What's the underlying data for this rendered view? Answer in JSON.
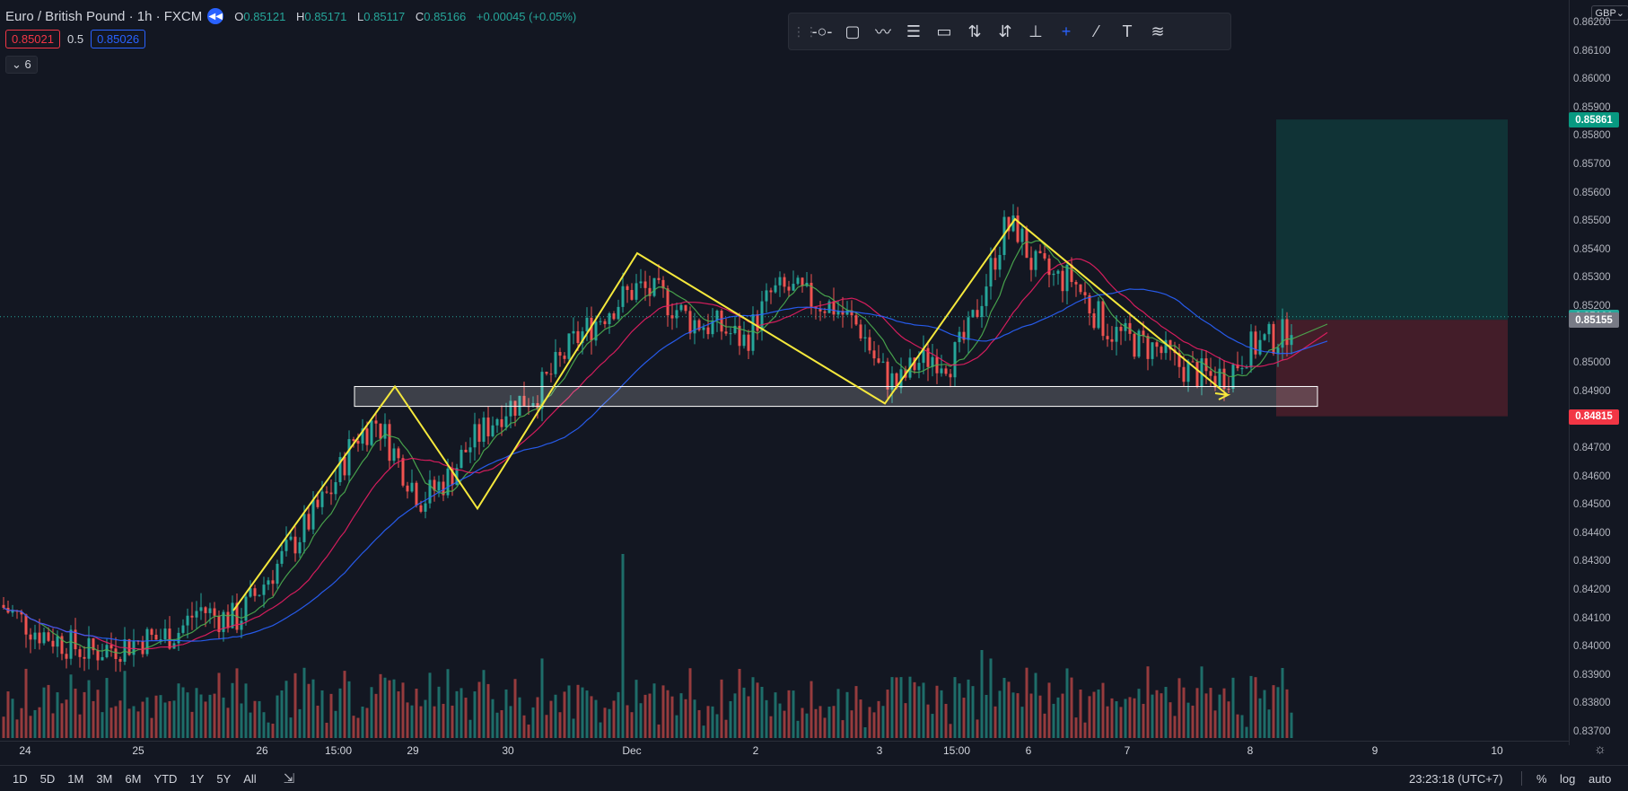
{
  "header": {
    "symbol": "Euro / British Pound · 1h · FXCM",
    "ohlc": [
      {
        "k": "O",
        "v": "0.85121"
      },
      {
        "k": "H",
        "v": "0.85171"
      },
      {
        "k": "L",
        "v": "0.85117"
      },
      {
        "k": "C",
        "v": "0.85166"
      }
    ],
    "change": "+0.00045 (+0.05%)",
    "sell_price": "0.85021",
    "spread": "0.5",
    "buy_price": "0.85026",
    "indicators_toggle": "6"
  },
  "toolbar_icons": [
    "horizontal-ray-icon",
    "rectangle-icon",
    "path-icon",
    "parallel-channel-icon",
    "callout-icon",
    "long-position-icon",
    "short-position-icon",
    "price-range-icon",
    "crosshair-icon",
    "trend-line-icon",
    "text-icon",
    "fib-fan-icon"
  ],
  "currency_button": "GBP",
  "price_axis": {
    "labels": [
      "0.86200",
      "0.86100",
      "0.86000",
      "0.85900",
      "0.85800",
      "0.85700",
      "0.85600",
      "0.85500",
      "0.85400",
      "0.85300",
      "0.85200",
      "0.85000",
      "0.84900",
      "0.84700",
      "0.84600",
      "0.84500",
      "0.84400",
      "0.84300",
      "0.84200",
      "0.84100",
      "0.84000",
      "0.83900",
      "0.83800",
      "0.83700"
    ],
    "tags": {
      "target": "0.85861",
      "last": "0.85166",
      "prev": "0.85155",
      "stop": "0.84815"
    }
  },
  "time_axis": [
    "24",
    "25",
    "26",
    "15:00",
    "29",
    "30",
    "Dec",
    "2",
    "3",
    "15:00",
    "6",
    "7",
    "8",
    "9",
    "10"
  ],
  "bottom_bar": {
    "ranges": [
      "1D",
      "5D",
      "1M",
      "3M",
      "6M",
      "YTD",
      "1Y",
      "5Y",
      "All"
    ],
    "clock": "23:23:18 (UTC+7)",
    "percent": "%",
    "log": "log",
    "auto": "auto"
  },
  "colors": {
    "up": "#26a69a",
    "down": "#ef5350",
    "pattern": "#f5e83c",
    "ma_green": "#4caf50",
    "ma_red": "#e91e63",
    "ma_blue": "#2962ff"
  },
  "chart_data": {
    "type": "candlestick",
    "ylim": [
      0.837,
      0.8622
    ],
    "waypoints": [
      {
        "x": 0,
        "y": 0.8415
      },
      {
        "x": 40,
        "y": 0.8406
      },
      {
        "x": 70,
        "y": 0.8402
      },
      {
        "x": 100,
        "y": 0.8398
      },
      {
        "x": 120,
        "y": 0.84
      },
      {
        "x": 140,
        "y": 0.8401
      },
      {
        "x": 160,
        "y": 0.8403
      },
      {
        "x": 175,
        "y": 0.8403
      },
      {
        "x": 200,
        "y": 0.8406
      },
      {
        "x": 222,
        "y": 0.8414
      },
      {
        "x": 240,
        "y": 0.8411
      },
      {
        "x": 265,
        "y": 0.841
      },
      {
        "x": 290,
        "y": 0.8421
      },
      {
        "x": 330,
        "y": 0.8438
      },
      {
        "x": 370,
        "y": 0.8456
      },
      {
        "x": 395,
        "y": 0.8474
      },
      {
        "x": 420,
        "y": 0.848
      },
      {
        "x": 445,
        "y": 0.8465
      },
      {
        "x": 470,
        "y": 0.8452
      },
      {
        "x": 500,
        "y": 0.846
      },
      {
        "x": 520,
        "y": 0.847
      },
      {
        "x": 560,
        "y": 0.8484
      },
      {
        "x": 600,
        "y": 0.849
      },
      {
        "x": 640,
        "y": 0.8508
      },
      {
        "x": 680,
        "y": 0.852
      },
      {
        "x": 710,
        "y": 0.8527
      },
      {
        "x": 740,
        "y": 0.8523
      },
      {
        "x": 770,
        "y": 0.8515
      },
      {
        "x": 800,
        "y": 0.8513
      },
      {
        "x": 830,
        "y": 0.8508
      },
      {
        "x": 860,
        "y": 0.8525
      },
      {
        "x": 880,
        "y": 0.8526
      },
      {
        "x": 900,
        "y": 0.8523
      },
      {
        "x": 930,
        "y": 0.852
      },
      {
        "x": 960,
        "y": 0.8512
      },
      {
        "x": 980,
        "y": 0.8498
      },
      {
        "x": 1000,
        "y": 0.8492
      },
      {
        "x": 1020,
        "y": 0.85
      },
      {
        "x": 1040,
        "y": 0.8503
      },
      {
        "x": 1060,
        "y": 0.8501
      },
      {
        "x": 1080,
        "y": 0.8511
      },
      {
        "x": 1100,
        "y": 0.853
      },
      {
        "x": 1120,
        "y": 0.8548
      },
      {
        "x": 1135,
        "y": 0.8547
      },
      {
        "x": 1150,
        "y": 0.8535
      },
      {
        "x": 1175,
        "y": 0.853
      },
      {
        "x": 1195,
        "y": 0.853
      },
      {
        "x": 1215,
        "y": 0.852
      },
      {
        "x": 1235,
        "y": 0.8512
      },
      {
        "x": 1260,
        "y": 0.8508
      },
      {
        "x": 1290,
        "y": 0.8505
      },
      {
        "x": 1310,
        "y": 0.85
      },
      {
        "x": 1330,
        "y": 0.8497
      },
      {
        "x": 1350,
        "y": 0.8495
      },
      {
        "x": 1370,
        "y": 0.8497
      },
      {
        "x": 1390,
        "y": 0.8505
      },
      {
        "x": 1410,
        "y": 0.8508
      },
      {
        "x": 1430,
        "y": 0.851
      },
      {
        "x": 1442,
        "y": 0.8517
      }
    ],
    "pattern_line": [
      {
        "x": 260,
        "y": 0.8413
      },
      {
        "x": 440,
        "y": 0.8492
      },
      {
        "x": 532,
        "y": 0.8449
      },
      {
        "x": 710,
        "y": 0.8539
      },
      {
        "x": 986,
        "y": 0.8486
      },
      {
        "x": 1131,
        "y": 0.8551
      },
      {
        "x": 1368,
        "y": 0.8489
      }
    ],
    "support_zone": {
      "x": [
        395,
        1468
      ],
      "y": [
        0.8485,
        0.8492
      ]
    },
    "position": {
      "x": [
        1422,
        1680
      ],
      "entry": 0.85155,
      "target": 0.85861,
      "stop": 0.84815
    },
    "last_price": 0.85166
  }
}
